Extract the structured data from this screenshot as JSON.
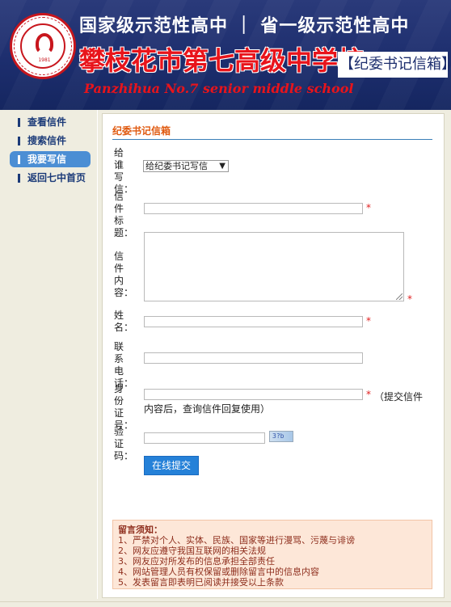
{
  "header": {
    "line1": "国家级示范性高中 ｜ 省一级示范性高中",
    "school_name": "攀枝花市第七高级中学校",
    "tag": "【纪委书记信箱】",
    "english_name": "Panzhihua No.7 senior middle school",
    "logo_year": "1981"
  },
  "sidebar": {
    "items": [
      {
        "label": "查看信件",
        "active": false
      },
      {
        "label": "搜索信件",
        "active": false
      },
      {
        "label": "我要写信",
        "active": true
      },
      {
        "label": "返回七中首页",
        "active": false
      }
    ]
  },
  "form": {
    "section_title": "纪委书记信箱",
    "to_label": [
      "给谁",
      "写",
      "信："
    ],
    "to_selected": "给纪委书记写信",
    "title_label": [
      "信件",
      "标",
      "题："
    ],
    "content_label": [
      "信件",
      "内",
      "容："
    ],
    "name_label": [
      "姓",
      "名："
    ],
    "phone_label": [
      "联系",
      "电",
      "话："
    ],
    "id_label": [
      "身份",
      "证",
      "号："
    ],
    "captcha_label": [
      "验证",
      "码："
    ],
    "required_mark": "*",
    "id_hint_1": "（提交信件",
    "id_hint_2": "内容后，查询信件回复使用）",
    "captcha_text": "3?b",
    "submit_label": "在线提交"
  },
  "notice": {
    "title": "留言须知：",
    "items": [
      "1、严禁对个人、实体、民族、国家等进行漫骂、污蔑与诽谤",
      "2、网友应遵守我国互联网的相关法规",
      "3、网友应对所发布的信息承担全部责任",
      "4、网站管理人员有权保留或删除留言中的信息内容",
      "5、发表留言即表明已阅读并接受以上条款"
    ]
  },
  "colors": {
    "header_bg": "#1d2e6e",
    "school_red": "#e8141b",
    "nav_active": "#4b8ed4",
    "submit_bg": "#2581d8",
    "notice_bg": "#fde7d8"
  }
}
